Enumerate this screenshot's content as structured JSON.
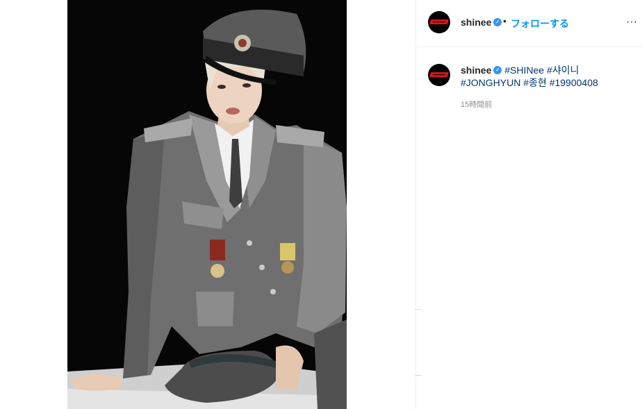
{
  "post": {
    "username": "shinee",
    "follow_label": "フォローする",
    "separator": "•",
    "more_label": "···"
  },
  "caption": {
    "username": "shinee",
    "hashtags": [
      "#SHINee",
      "#샤이니",
      "#JONGHYUN",
      "#종현",
      "#19900408"
    ],
    "timestamp": "15時間前"
  },
  "icons": {
    "verified": "verified-badge-icon",
    "more": "more-options-icon",
    "avatar": "shinee-logo-avatar"
  },
  "colors": {
    "accent": "#0095f6",
    "hashtag": "#00376b",
    "verified": "#3897f0",
    "logo_red": "#d4141e"
  }
}
